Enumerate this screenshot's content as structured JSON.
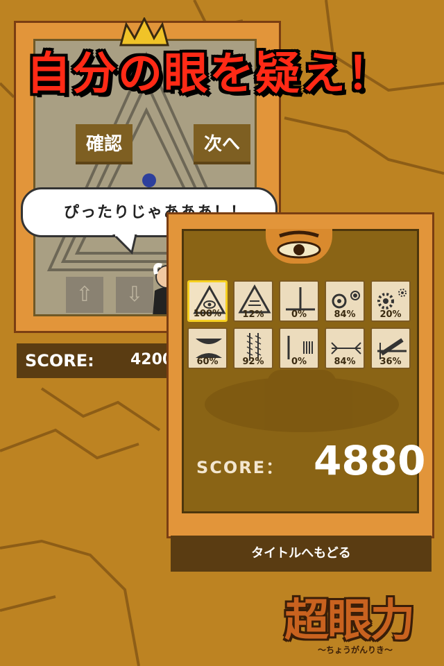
{
  "headline": "自分の眼を疑え！",
  "back_card": {
    "confirm_label": "確認",
    "next_label": "次へ",
    "up_label": "⇧",
    "down_label": "⇩",
    "speech": "ぴったりじゃあああ！！",
    "score_label": "SCORE:",
    "score_value": "4200"
  },
  "results": {
    "cells": [
      {
        "icon": "eye-triangle-icon",
        "pct": "100%",
        "selected": true
      },
      {
        "icon": "triangle-lines-icon",
        "pct": "12%",
        "selected": false
      },
      {
        "icon": "perpendicular-icon",
        "pct": "0%",
        "selected": false
      },
      {
        "icon": "circles-icon",
        "pct": "84%",
        "selected": false
      },
      {
        "icon": "flowers-icon",
        "pct": "20%",
        "selected": false
      },
      {
        "icon": "curves-icon",
        "pct": "60%",
        "selected": false
      },
      {
        "icon": "hatched-lines-icon",
        "pct": "92%",
        "selected": false
      },
      {
        "icon": "bars-icon",
        "pct": "0%",
        "selected": false
      },
      {
        "icon": "arrows-icon",
        "pct": "84%",
        "selected": false
      },
      {
        "icon": "slanted-bar-icon",
        "pct": "36%",
        "selected": false
      }
    ],
    "score_label": "SCORE：",
    "score_value": "4880"
  },
  "title_button": "タイトルへもどる",
  "logo": {
    "title": "超眼力",
    "subtitle": "〜ちょうがんりき〜"
  },
  "colors": {
    "background": "#bd8322",
    "card": "#e2953a",
    "accent_red": "#ff2a16"
  }
}
